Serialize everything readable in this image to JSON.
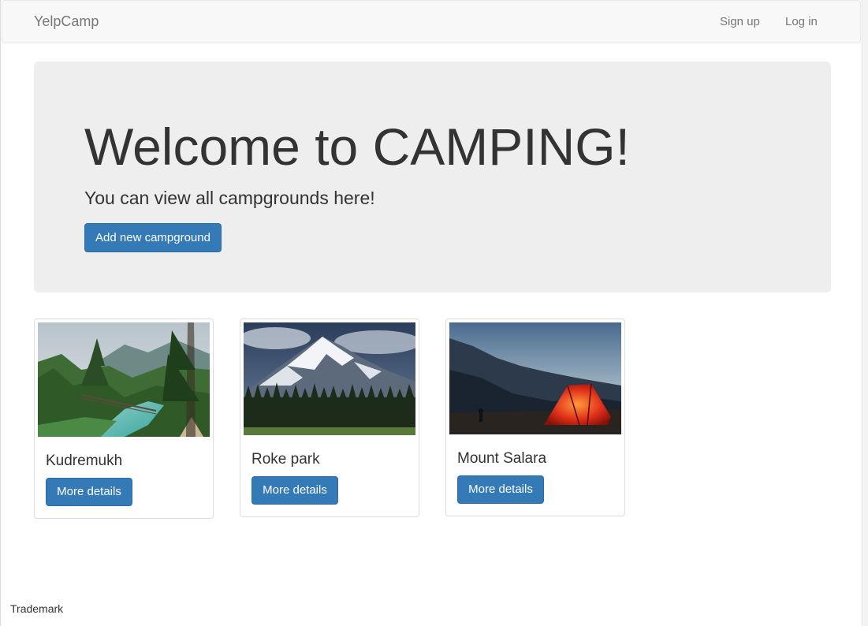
{
  "navbar": {
    "brand": "YelpCamp",
    "links": [
      "Sign up",
      "Log in"
    ]
  },
  "jumbotron": {
    "title": "Welcome to CAMPING!",
    "subtitle": "You can view all campgrounds here!",
    "button_label": "Add new campground"
  },
  "campgrounds": [
    {
      "name": "Kudremukh",
      "button_label": "More details",
      "image": "forest-river-bridge-photo"
    },
    {
      "name": "Roke park",
      "button_label": "More details",
      "image": "snowy-mountain-forest-photo"
    },
    {
      "name": "Mount Salara",
      "button_label": "More details",
      "image": "mountain-tent-dusk-photo"
    }
  ],
  "footer": {
    "text": "Trademark"
  },
  "colors": {
    "primary": "#337ab7",
    "navbar_bg": "#f8f8f8",
    "jumbotron_bg": "#eeeeee"
  }
}
